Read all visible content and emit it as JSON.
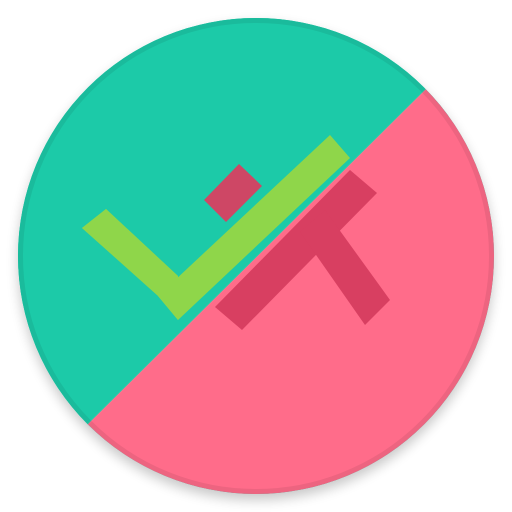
{
  "icon": {
    "name": "todo-app-icon",
    "colors": {
      "background": "#ffffff",
      "teal": "#1ccaa8",
      "teal_dark": "#16ad90",
      "pink": "#ff6c8a",
      "pink_dark": "#db4a69",
      "cross": "#d83f61",
      "check": "#8fd64a"
    },
    "symbols": [
      "check-icon",
      "cross-icon"
    ]
  }
}
